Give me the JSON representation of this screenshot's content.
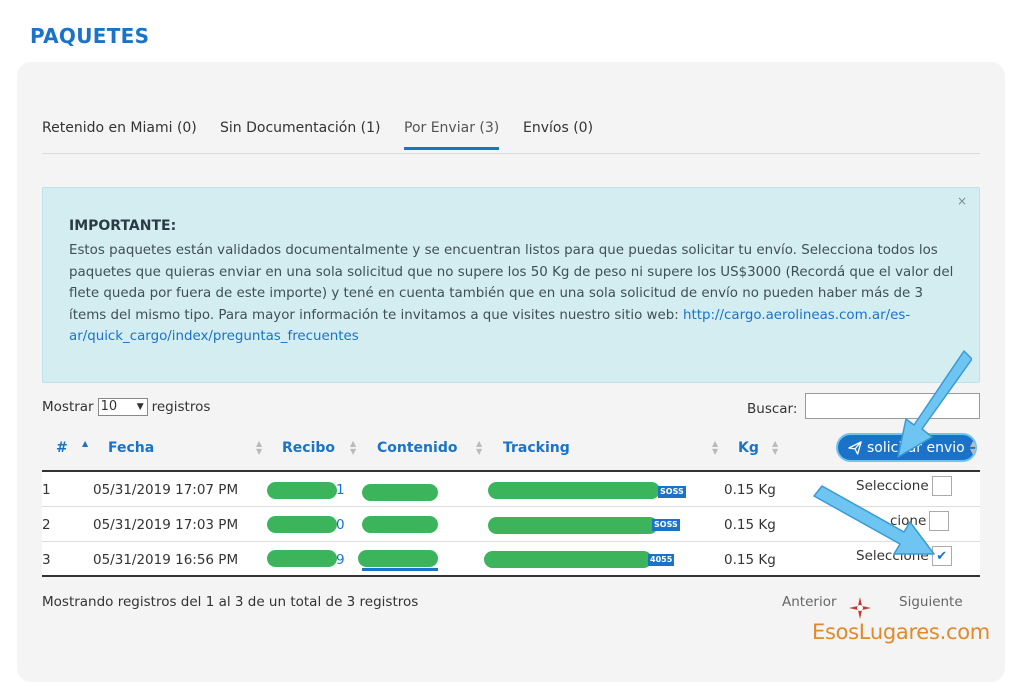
{
  "page": {
    "title": "PAQUETES"
  },
  "tabs": [
    {
      "label": "Retenido en Miami (0)"
    },
    {
      "label": "Sin Documentación (1)"
    },
    {
      "label": "Por Enviar (3)"
    },
    {
      "label": "Envíos (0)"
    }
  ],
  "alert": {
    "title": "IMPORTANTE:",
    "body": "Estos paquetes están validados documentalmente y se encuentran listos para que puedas solicitar tu envío. Selecciona todos los paquetes que quieras enviar en una sola solicitud que no supere los 50 Kg de peso ni supere los US$3000 (Recordá que el valor del flete queda por fuera de este importe) y tené en cuenta también que en una sola solicitud de envío no pueden haber más de 3 ítems del mismo tipo. Para mayor información te invitamos a que visites nuestro sitio web: ",
    "link": "http://cargo.aerolineas.com.ar/es-ar/quick_cargo/index/preguntas_frecuentes",
    "close": "×"
  },
  "table_controls": {
    "show_label": "Mostrar",
    "page_size": "10",
    "records_label": "registros",
    "search_label": "Buscar:",
    "search_value": ""
  },
  "table": {
    "headers": {
      "num": "#",
      "date": "Fecha",
      "receipt": "Recibo",
      "content": "Contenido",
      "tracking": "Tracking",
      "kg": "Kg"
    },
    "request_button": "solicitar envio",
    "rows": [
      {
        "num": "1",
        "date": "05/31/2019 17:07 PM",
        "receipt_tail": "1",
        "tracking_tag": "SOSS",
        "kg": "0.15 Kg",
        "select_label": "Seleccione",
        "checked": false
      },
      {
        "num": "2",
        "date": "05/31/2019 17:03 PM",
        "receipt_tail": "0",
        "tracking_tag": "SOSS",
        "kg": "0.15 Kg",
        "select_label": "cione",
        "checked": false
      },
      {
        "num": "3",
        "date": "05/31/2019 16:56 PM",
        "receipt_tail": "9",
        "tracking_tag": "4055",
        "kg": "0.15 Kg",
        "select_label": "Seleccione",
        "checked": true
      }
    ]
  },
  "footer": {
    "info": "Mostrando registros del 1 al 3 de un total de 3 registros",
    "prev": "Anterior",
    "next": "Siguiente"
  },
  "watermark": {
    "text": "EsosLugares.com"
  },
  "colors": {
    "brand": "#1a73c8",
    "alert_bg": "#d4edf1",
    "redaction": "#3cb45c",
    "pointer": "#6ec5f2",
    "watermark": "#e08a2a"
  }
}
